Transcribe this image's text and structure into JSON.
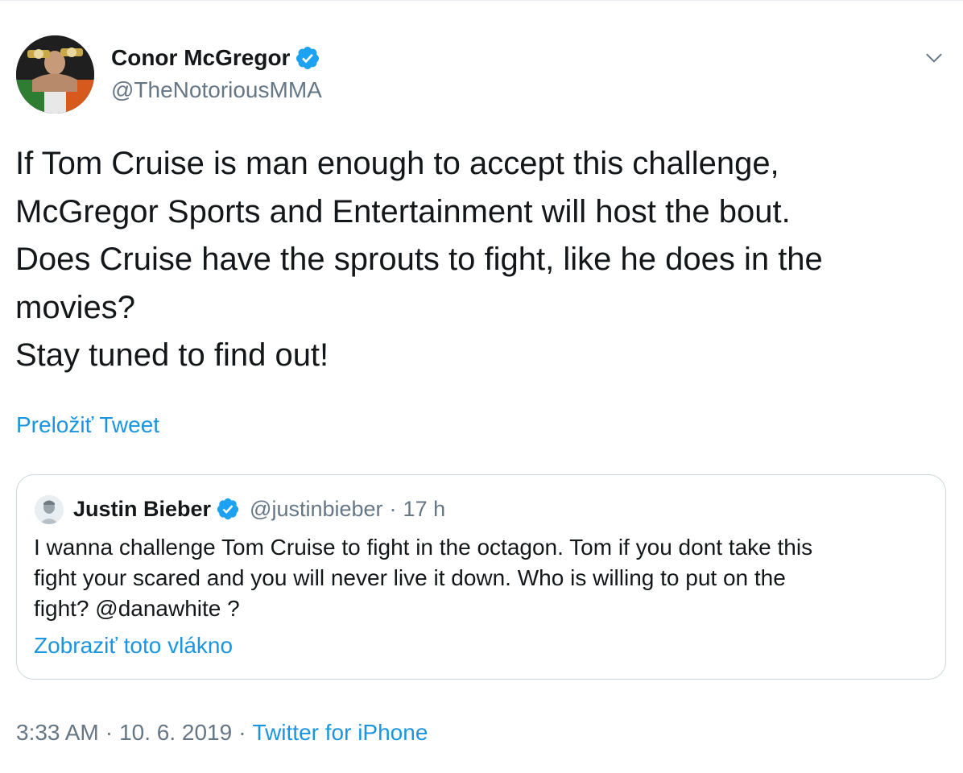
{
  "author": {
    "display_name": "Conor McGregor",
    "handle": "@TheNotoriousMMA",
    "avatar_icon": "profile-photo",
    "verified_icon": "verified-badge-icon"
  },
  "tweet": {
    "lines": [
      "If Tom Cruise is man enough to accept this challenge,",
      "McGregor Sports and Entertainment will host the bout.",
      "Does Cruise have the sprouts to fight, like he does in the",
      "movies?",
      "Stay tuned to find out!"
    ],
    "translate_label": "Preložiť Tweet"
  },
  "quoted": {
    "display_name": "Justin Bieber",
    "handle": "@justinbieber",
    "separator": "·",
    "time": "17 h",
    "lines": [
      "I wanna challenge Tom Cruise to fight in the octagon. Tom if you dont take this",
      "fight your scared and you will never live it down. Who is willing to put on the",
      "fight? @danawhite ?"
    ],
    "thread_label": "Zobraziť toto vlákno"
  },
  "meta": {
    "time": "3:33 AM",
    "separator": "·",
    "date": "10. 6. 2019",
    "source": "Twitter for iPhone"
  },
  "colors": {
    "link": "#1b95e0",
    "muted": "#657786",
    "text": "#14171a",
    "border": "#ccd6dd",
    "verified": "#1da1f2"
  }
}
